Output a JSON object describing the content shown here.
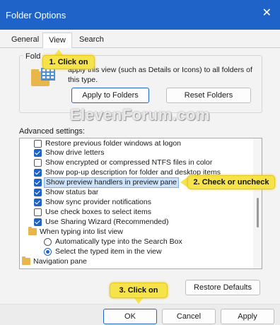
{
  "window": {
    "title": "Folder Options",
    "close_glyph": "✕"
  },
  "tabs": [
    {
      "label": "General"
    },
    {
      "label": "View",
      "active": true
    },
    {
      "label": "Search"
    }
  ],
  "folder_views": {
    "title": "Fold",
    "description": "apply this view (such as Details or Icons) to all folders of this type.",
    "apply_button": "Apply to Folders",
    "reset_button": "Reset Folders"
  },
  "watermark": "ElevenForum.com",
  "advanced": {
    "label": "Advanced settings:",
    "items": [
      {
        "kind": "checkbox",
        "checked": false,
        "label": "Restore previous folder windows at logon"
      },
      {
        "kind": "checkbox",
        "checked": true,
        "label": "Show drive letters"
      },
      {
        "kind": "checkbox",
        "checked": false,
        "label": "Show encrypted or compressed NTFS files in color"
      },
      {
        "kind": "checkbox",
        "checked": true,
        "label": "Show pop-up description for folder and desktop items"
      },
      {
        "kind": "checkbox",
        "checked": true,
        "label": "Show preview handlers in preview pane",
        "selected": true
      },
      {
        "kind": "checkbox",
        "checked": true,
        "label": "Show status bar"
      },
      {
        "kind": "checkbox",
        "checked": true,
        "label": "Show sync provider notifications"
      },
      {
        "kind": "checkbox",
        "checked": false,
        "label": "Use check boxes to select items"
      },
      {
        "kind": "checkbox",
        "checked": true,
        "label": "Use Sharing Wizard (Recommended)"
      },
      {
        "kind": "folder",
        "label": "When typing into list view"
      },
      {
        "kind": "radio",
        "checked": false,
        "label": "Automatically type into the Search Box"
      },
      {
        "kind": "radio",
        "checked": true,
        "label": "Select the typed item in the view"
      },
      {
        "kind": "folder",
        "label": "Navigation pane"
      }
    ]
  },
  "buttons": {
    "restore_defaults": "Restore Defaults",
    "ok": "OK",
    "cancel": "Cancel",
    "apply": "Apply"
  },
  "callouts": {
    "step1": "1. Click on",
    "step2": "2. Check or uncheck",
    "step3": "3. Click on"
  },
  "colors": {
    "accent": "#1f63c8",
    "callout": "#f6e24b"
  }
}
